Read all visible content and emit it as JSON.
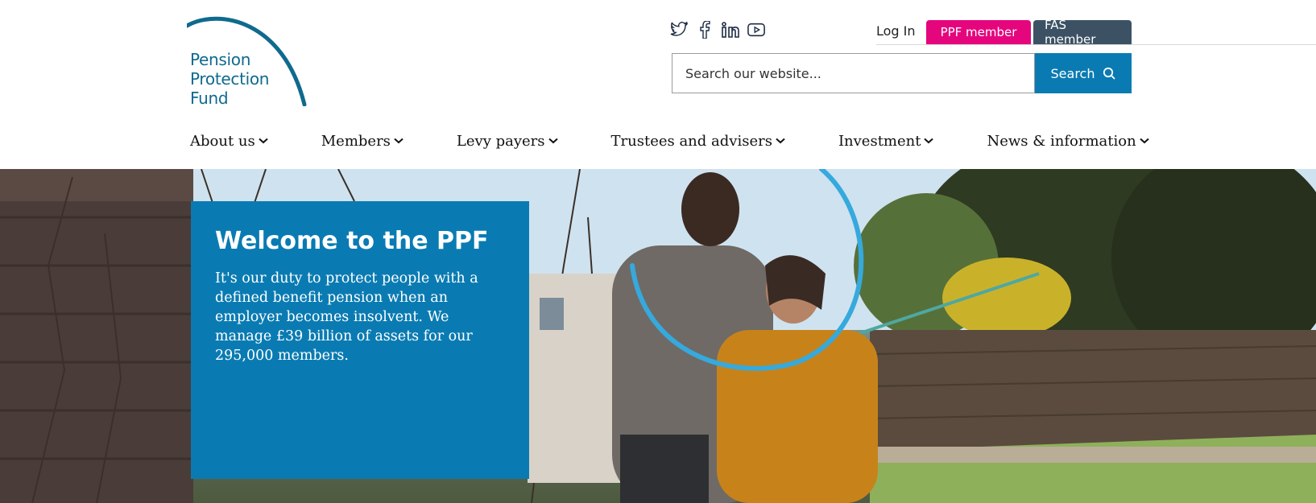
{
  "logo": {
    "line1": "Pension",
    "line2": "Protection",
    "line3": "Fund"
  },
  "social": [
    {
      "name": "twitter-icon"
    },
    {
      "name": "facebook-icon"
    },
    {
      "name": "linkedin-icon"
    },
    {
      "name": "youtube-icon"
    }
  ],
  "header": {
    "login_label": "Log In",
    "ppf_member_label": "PPF member",
    "fas_member_label": "FAS member"
  },
  "search": {
    "placeholder": "Search our website...",
    "button_label": "Search"
  },
  "nav": {
    "items": [
      {
        "label": "About us"
      },
      {
        "label": "Members"
      },
      {
        "label": "Levy payers"
      },
      {
        "label": "Trustees and advisers"
      },
      {
        "label": "Investment"
      },
      {
        "label": "News & information"
      }
    ]
  },
  "hero": {
    "title": "Welcome to the PPF",
    "body": "It's our duty to protect people with a defined benefit pension when an employer becomes insolvent. We manage £39 billion of assets for our 295,000 members."
  },
  "colors": {
    "brand_blue": "#0a7bb2",
    "ppf_pink": "#e5067d",
    "fas_slate": "#3c5264",
    "logo_teal": "#0f6a8e"
  }
}
